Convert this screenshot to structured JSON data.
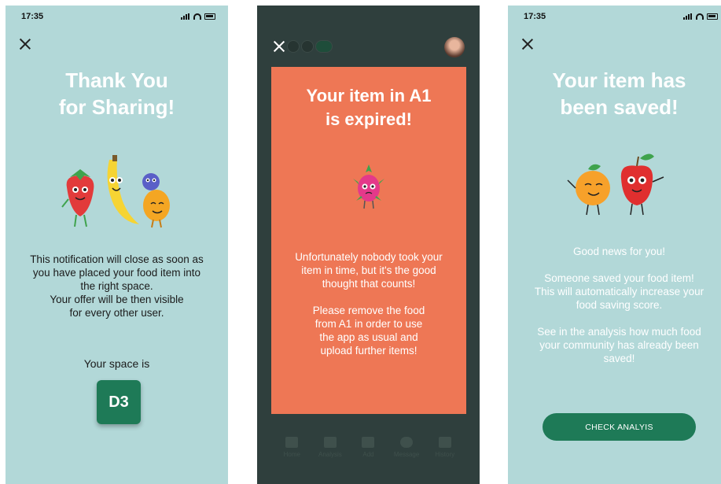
{
  "status_time": "17:35",
  "screen1": {
    "title": "Thank You\nfor Sharing!",
    "illustration": "strawberry-banana-blueberry-mango-characters",
    "message": "This notification will close as soon as\nyou have placed your food item into\nthe right space.\nYour offer will be then visible\nfor every other user.",
    "space_label": "Your space is",
    "space_code": "D3",
    "accent": "#1e7a57"
  },
  "screen2": {
    "title": "Your item in A1\nis expired!",
    "illustration": "dragonfruit-character",
    "message": "Unfortunately nobody took your\nitem in time, but it's the good\nthought that counts!\n\nPlease remove the food\nfrom A1 in order to use\nthe app as usual and\nupload further items!",
    "modal_color": "#ee7755",
    "tabs": [
      {
        "label": "Home",
        "icon": "home-icon"
      },
      {
        "label": "Analysis",
        "icon": "chart-icon"
      },
      {
        "label": "Add",
        "icon": "plus-icon"
      },
      {
        "label": "Message",
        "icon": "chat-icon"
      },
      {
        "label": "History",
        "icon": "history-icon"
      }
    ]
  },
  "screen3": {
    "title": "Your item has\nbeen saved!",
    "illustration": "orange-apple-characters",
    "message": "Good news for you!\n\nSomeone saved your food item!\nThis will automatically increase your\nfood saving score.\n\nSee in the analysis how much food\nyour community has already been\nsaved!",
    "button_label": "CHECK ANALYIS"
  }
}
